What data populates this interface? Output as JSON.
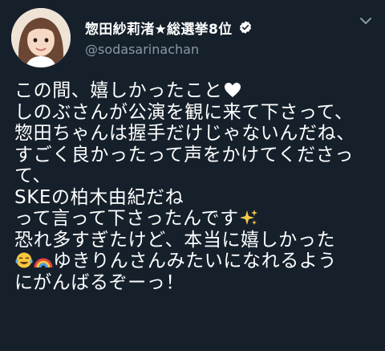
{
  "user": {
    "display_name": "惣田紗莉渚★総選挙8位",
    "handle": "@sodasarinachan",
    "verified": true
  },
  "icons": {
    "verified": "verified-badge-icon",
    "menu": "chevron-down-icon",
    "heart": "heart-emoji",
    "sparkles": "sparkles-emoji",
    "tears_of_joy": "tears-of-joy-emoji",
    "rainbow": "rainbow-emoji"
  },
  "colors": {
    "background": "#15202b",
    "text": "#ffffff",
    "secondary_text": "#8899a6",
    "verified": "#ffffff"
  },
  "tweet": {
    "lines": [
      "この間、嬉しかったこと",
      "しのぶさんが公演を観に来て下さって、",
      "惣田ちゃんは握手だけじゃないんだね、",
      "すごく良かったって声をかけてくださっ",
      "て、",
      "SKEの柏木由紀だね",
      "って言って下さったんです",
      "恐れ多すぎたけど、本当に嬉しかった",
      "ゆきりんさんみたいになれるよう",
      "にがんばるぞーっ！"
    ]
  }
}
